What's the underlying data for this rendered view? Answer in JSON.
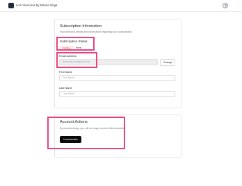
{
  "app": {
    "title": "Lion Vivacious by Marina Girga",
    "logo_icon": "square-logo",
    "profile_icon": "user-avatar-icon"
  },
  "subscription_card": {
    "title": "Subscription Information",
    "subtitle": "Your personal details and information regarding your subscription.",
    "status_label": "Subscription Status",
    "status_badge": "Inactive",
    "plan": "Free",
    "email_label": "Email Address",
    "email_value": "lionvivacious@gmail.com",
    "change_button": "Change",
    "first_name_label": "First Name",
    "first_name_placeholder": "First Name",
    "last_name_label": "Last Name",
    "last_name_placeholder": "Last Name"
  },
  "account_card": {
    "title": "Account Actions",
    "description": "By unsubscribing, you will no longer receive this newsletter.",
    "unsubscribe_button": "Unsubscribe"
  },
  "colors": {
    "highlight": "#e8417c",
    "badge_bg": "#fdecea",
    "badge_text": "#c62828",
    "primary_button": "#0a0a0a"
  }
}
